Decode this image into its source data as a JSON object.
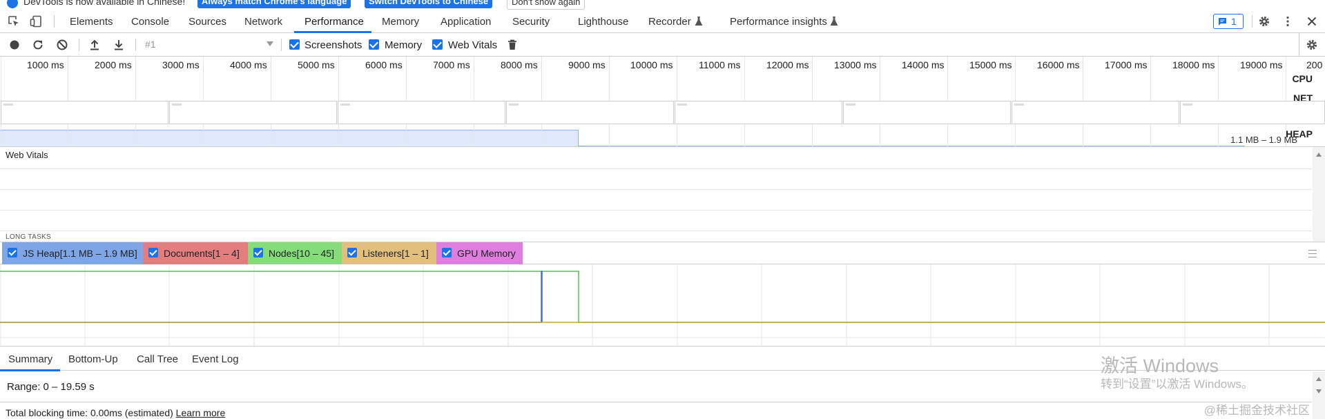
{
  "infobar": {
    "message": "DevTools is now available in Chinese!",
    "buttons": [
      "Always match Chrome's language",
      "Switch DevTools to Chinese",
      "Don't show again"
    ]
  },
  "main_tabs": [
    "Elements",
    "Console",
    "Sources",
    "Network",
    "Performance",
    "Memory",
    "Application",
    "Security",
    "Lighthouse",
    "Recorder",
    "Performance insights"
  ],
  "active_tab": "Performance",
  "issues_count": "1",
  "toolbar": {
    "recording_select": "#1",
    "checkboxes": [
      "Screenshots",
      "Memory",
      "Web Vitals"
    ]
  },
  "overview": {
    "time_labels": [
      "1000 ms",
      "2000 ms",
      "3000 ms",
      "4000 ms",
      "5000 ms",
      "6000 ms",
      "7000 ms",
      "8000 ms",
      "9000 ms",
      "10000 ms",
      "11000 ms",
      "12000 ms",
      "13000 ms",
      "14000 ms",
      "15000 ms",
      "16000 ms",
      "17000 ms",
      "18000 ms",
      "19000 ms",
      "200"
    ],
    "lanes": [
      "CPU",
      "NET",
      "HEAP"
    ],
    "heap_range": "1.1 MB – 1.9 MB"
  },
  "web_vitals": {
    "title": "Web Vitals",
    "long_tasks": "LONG TASKS"
  },
  "counters": [
    {
      "label": "JS Heap[1.1 MB – 1.9 MB]",
      "color": "#7ea6e6"
    },
    {
      "label": "Documents[1 – 4]",
      "color": "#e47d7d"
    },
    {
      "label": "Nodes[10 – 45]",
      "color": "#85dd7a"
    },
    {
      "label": "Listeners[1 – 1]",
      "color": "#e2bf7c"
    },
    {
      "label": "GPU Memory",
      "color": "#e07ee0"
    }
  ],
  "bottom_tabs": [
    "Summary",
    "Bottom-Up",
    "Call Tree",
    "Event Log"
  ],
  "active_bottom_tab": "Summary",
  "summary": {
    "range": "Range: 0 – 19.59 s",
    "tbt_text": "Total blocking time: 0.00ms (estimated)",
    "learn_more": "Learn more"
  },
  "watermark": {
    "line1": "激活 Windows",
    "line2": "转到“设置”以激活 Windows。",
    "site": "@稀土掘金技术社区"
  }
}
